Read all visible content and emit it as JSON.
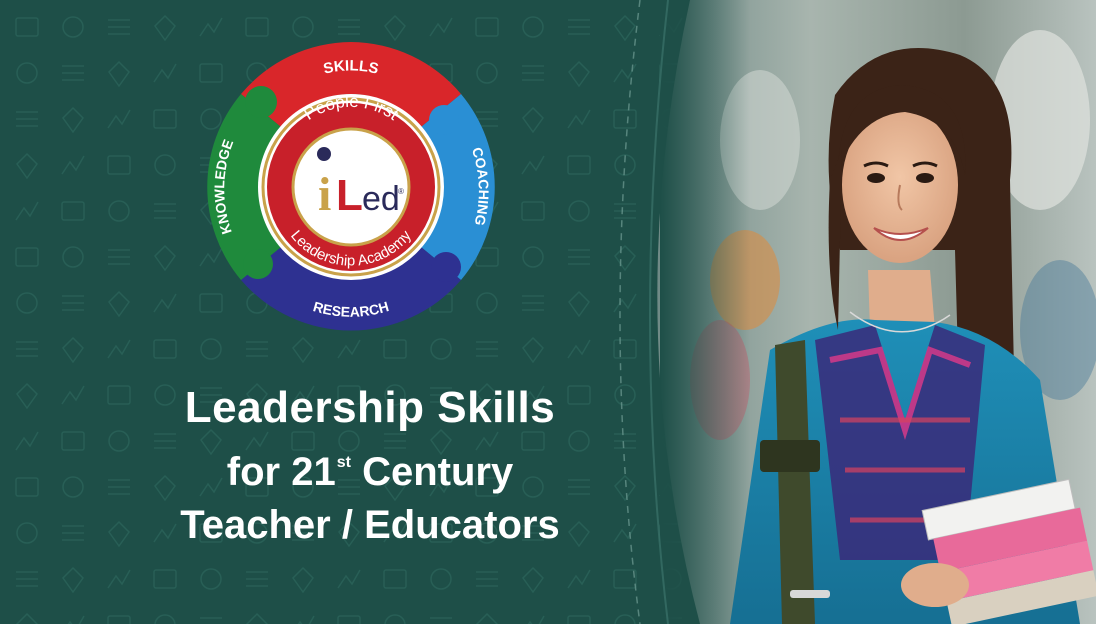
{
  "logo": {
    "arc_top": "SKILLS",
    "arc_right": "COACHING",
    "arc_bottom": "RESEARCH",
    "arc_left": "KNOWLEDGE",
    "ring_top": "People First",
    "ring_bottom": "Leadership Academy",
    "brand_i": "i",
    "brand_l": "L",
    "brand_ed": "ed",
    "brand_mark": "®"
  },
  "headline": {
    "line1": "Leadership Skills",
    "line2_pre": "for 21",
    "line2_sup": "st",
    "line2_post": "Century",
    "line3": "Teacher / Educators"
  },
  "colors": {
    "background": "#1e4f48",
    "skills_red": "#d9262a",
    "coaching_blue": "#2a8fd4",
    "research_navy": "#2e3191",
    "knowledge_green": "#1f8a3c",
    "brand_gold": "#c9a24a",
    "brand_red": "#c8202a",
    "headline_text": "#ffffff"
  },
  "photo": {
    "description_icon": "student-photo"
  }
}
